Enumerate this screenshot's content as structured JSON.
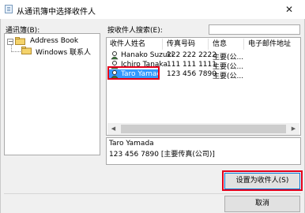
{
  "window": {
    "title": "从通讯簿中选择收件人",
    "close_glyph": "✕"
  },
  "left_panel": {
    "label": "通讯簿(B):",
    "tree": {
      "root": "Address Book",
      "child": "Windows 联系人"
    }
  },
  "search": {
    "label": "按收件人搜索(E):",
    "value": ""
  },
  "list": {
    "columns": [
      "收件人姓名",
      "传真号码",
      "信息",
      "电子邮件地址"
    ],
    "rows": [
      {
        "name": "Hanako Suzuki",
        "fax": "222 222 2222",
        "info": "主要(公...",
        "email": ""
      },
      {
        "name": "Ichiro Tanaka",
        "fax": "111 111 1111",
        "info": "主要(公...",
        "email": ""
      },
      {
        "name": "Taro Yamada",
        "fax": "123 456 7890",
        "info": "主要(公...",
        "email": "",
        "selected": true
      }
    ],
    "scroll_left": "◀",
    "scroll_right": "▶"
  },
  "details": {
    "line1": "Taro Yamada",
    "line2": "123 456 7890 [主要传真(公司)]"
  },
  "buttons": {
    "set_recipient": "设置为收件人(S)",
    "cancel": "取消"
  },
  "colors": {
    "selection": "#3399ff",
    "highlight_frame": "#e3001b"
  }
}
